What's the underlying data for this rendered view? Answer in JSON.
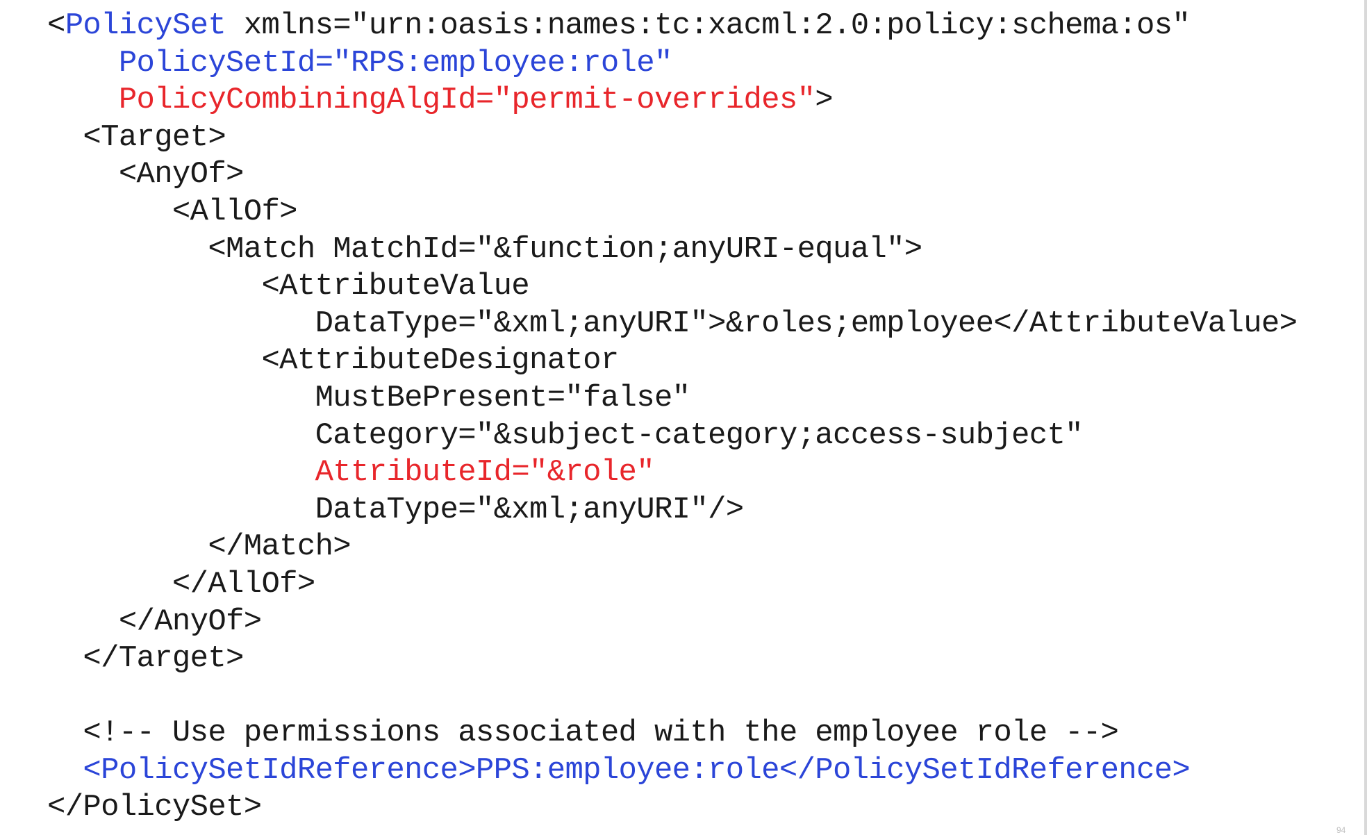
{
  "document": {
    "page_number": "94",
    "colors": {
      "default": "#1a1a1a",
      "blue": "#2b45d8",
      "red": "#e8262b"
    },
    "lines": [
      [
        {
          "text": "<",
          "color": "default"
        },
        {
          "text": "PolicySet",
          "color": "blue"
        },
        {
          "text": " xmlns=\"urn:oasis:names:tc:xacml:2.0:policy:schema:os\"",
          "color": "default"
        }
      ],
      [
        {
          "text": "    ",
          "color": "default"
        },
        {
          "text": "PolicySetId=\"RPS:employee:role\"",
          "color": "blue"
        }
      ],
      [
        {
          "text": "    ",
          "color": "default"
        },
        {
          "text": "PolicyCombiningAlgId=\"permit-overrides\"",
          "color": "red"
        },
        {
          "text": ">",
          "color": "default"
        }
      ],
      [
        {
          "text": "  <Target>",
          "color": "default"
        }
      ],
      [
        {
          "text": "    <AnyOf>",
          "color": "default"
        }
      ],
      [
        {
          "text": "       <AllOf>",
          "color": "default"
        }
      ],
      [
        {
          "text": "         <Match MatchId=\"&function;anyURI-equal\">",
          "color": "default"
        }
      ],
      [
        {
          "text": "            <AttributeValue",
          "color": "default"
        }
      ],
      [
        {
          "text": "               DataType=\"&xml;anyURI\">&roles;employee</AttributeValue>",
          "color": "default"
        }
      ],
      [
        {
          "text": "            <AttributeDesignator",
          "color": "default"
        }
      ],
      [
        {
          "text": "               MustBePresent=\"false\"",
          "color": "default"
        }
      ],
      [
        {
          "text": "               Category=\"&subject-category;access-subject\"",
          "color": "default"
        }
      ],
      [
        {
          "text": "               ",
          "color": "default"
        },
        {
          "text": "AttributeId=\"&role\"",
          "color": "red"
        }
      ],
      [
        {
          "text": "               DataType=\"&xml;anyURI\"/>",
          "color": "default"
        }
      ],
      [
        {
          "text": "         </Match>",
          "color": "default"
        }
      ],
      [
        {
          "text": "       </AllOf>",
          "color": "default"
        }
      ],
      [
        {
          "text": "    </AnyOf>",
          "color": "default"
        }
      ],
      [
        {
          "text": "  </Target>",
          "color": "default"
        }
      ],
      [],
      [
        {
          "text": "  <!-- Use permissions associated with the employee role -->",
          "color": "default"
        }
      ],
      [
        {
          "text": "  ",
          "color": "default"
        },
        {
          "text": "<PolicySetIdReference>PPS:employee:role</PolicySetIdReference>",
          "color": "blue"
        }
      ],
      [
        {
          "text": "</PolicySet>",
          "color": "default"
        }
      ]
    ]
  }
}
